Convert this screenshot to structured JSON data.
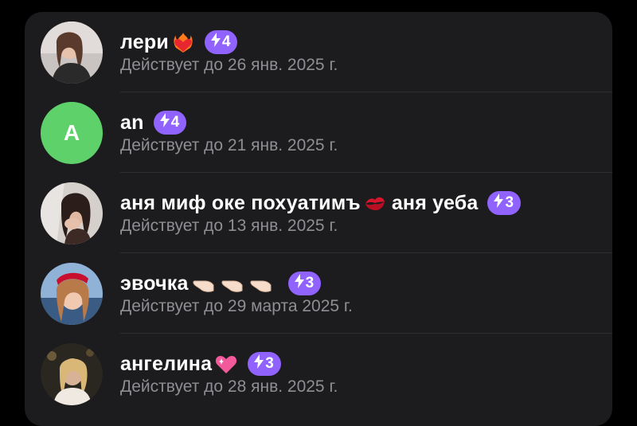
{
  "rows": [
    {
      "name": "лери",
      "emoji": "heart-on-fire",
      "level": "4",
      "expires": "Действует до 26 янв. 2025 г.",
      "avatar": "photo"
    },
    {
      "name": "an",
      "emoji": "",
      "level": "4",
      "expires": "Действует до 21 янв. 2025 г.",
      "avatar_letter": "A",
      "avatar_color": "#5fd16b"
    },
    {
      "name": "аня миф оке похуатимъ",
      "name_tail": "аня уеба",
      "emoji": "kiss-mark",
      "level": "3",
      "expires": "Действует до 13 янв. 2025 г.",
      "avatar": "photo"
    },
    {
      "name": "эвочка",
      "emoji": "pointing-hands",
      "level": "3",
      "expires": "Действует до 29 марта 2025 г.",
      "avatar": "photo"
    },
    {
      "name": "ангелина",
      "emoji": "pink-heart",
      "level": "3",
      "expires": "Действует до 28 янв. 2025 г.",
      "avatar": "photo"
    }
  ],
  "colors": {
    "badge": "#9063ff",
    "panel": "#1c1c1e",
    "subtext": "#8e8e93"
  }
}
